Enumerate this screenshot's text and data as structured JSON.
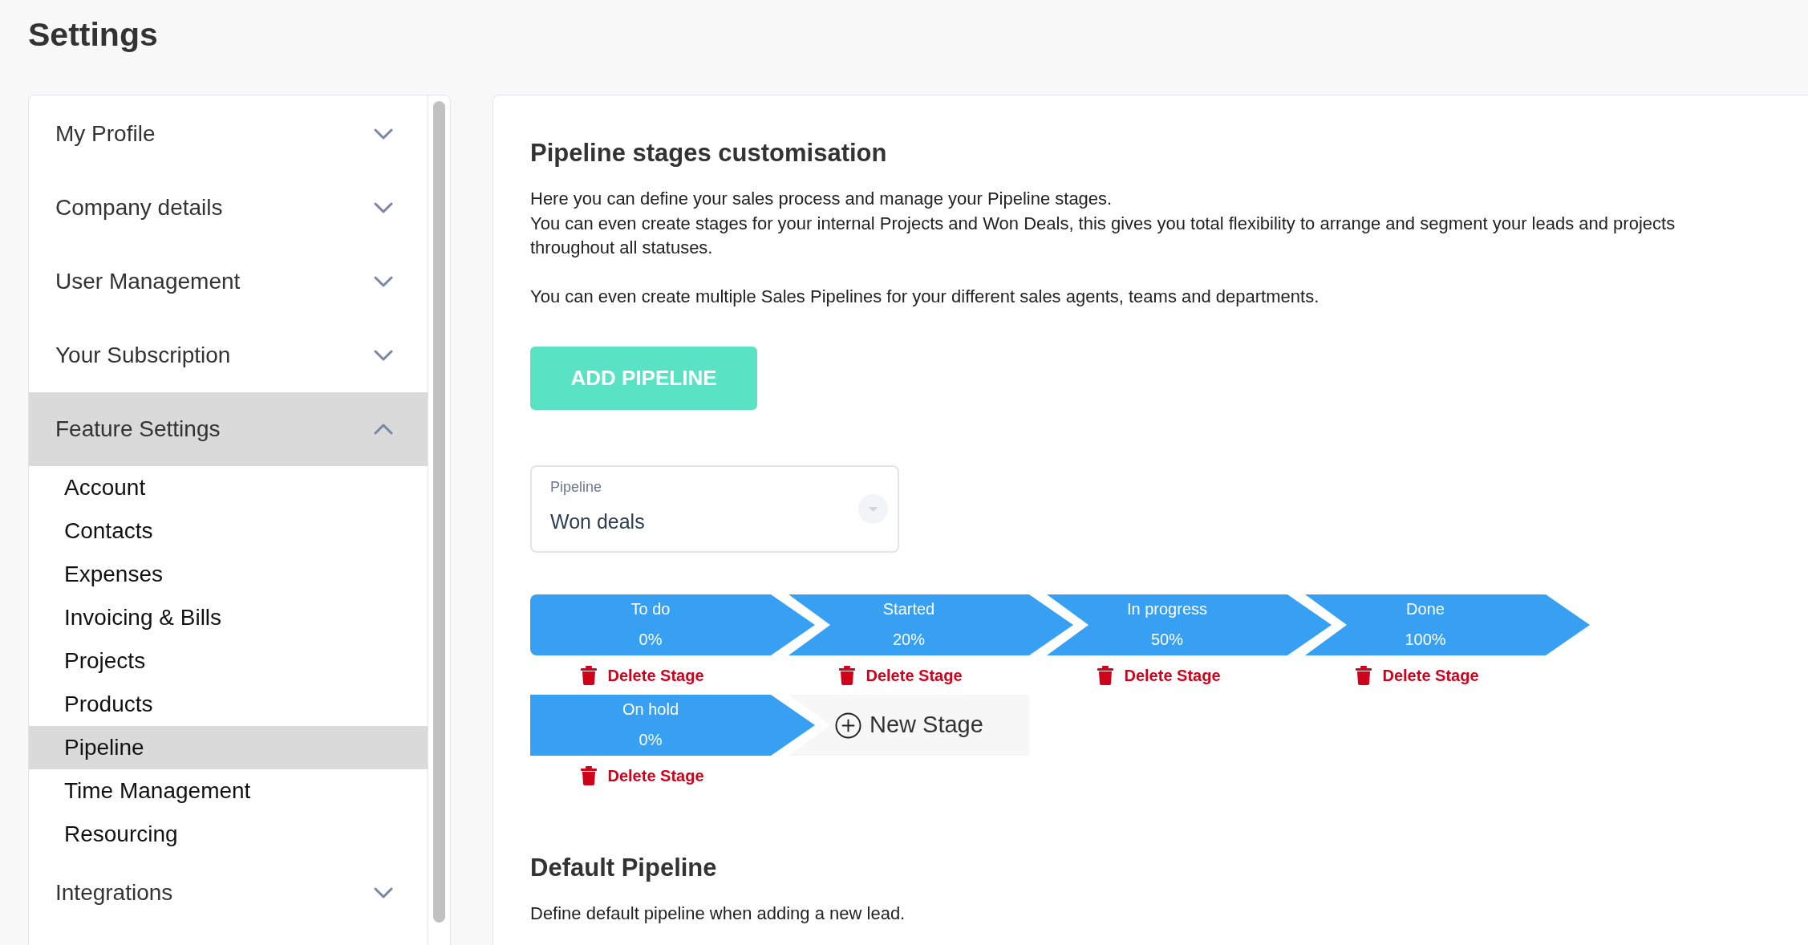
{
  "page_title": "Settings",
  "sidebar": {
    "sections": [
      {
        "label": "My Profile",
        "expanded": false
      },
      {
        "label": "Company details",
        "expanded": false
      },
      {
        "label": "User Management",
        "expanded": false
      },
      {
        "label": "Your Subscription",
        "expanded": false
      },
      {
        "label": "Feature Settings",
        "expanded": true,
        "children": [
          {
            "label": "Account",
            "selected": false
          },
          {
            "label": "Contacts",
            "selected": false
          },
          {
            "label": "Expenses",
            "selected": false
          },
          {
            "label": "Invoicing & Bills",
            "selected": false
          },
          {
            "label": "Projects",
            "selected": false
          },
          {
            "label": "Products",
            "selected": false
          },
          {
            "label": "Pipeline",
            "selected": true
          },
          {
            "label": "Time Management",
            "selected": false
          },
          {
            "label": "Resourcing",
            "selected": false
          }
        ]
      },
      {
        "label": "Integrations",
        "expanded": false
      }
    ]
  },
  "pipeline_stages": {
    "title": "Pipeline stages customisation",
    "paragraphs": [
      [
        "Here you can define your sales process and manage your Pipeline stages.",
        "You can even create stages for your internal Projects and Won Deals, this gives you total flexibility to arrange and segment your leads and projects throughout all statuses."
      ],
      [
        "You can even create multiple Sales Pipelines for your different sales agents, teams and departments."
      ]
    ],
    "add_button": "ADD PIPELINE",
    "pipeline_select": {
      "label": "Pipeline",
      "value": "Won deals"
    },
    "stages": [
      {
        "name": "To do",
        "percent": "0%",
        "delete_label": "Delete Stage"
      },
      {
        "name": "Started",
        "percent": "20%",
        "delete_label": "Delete Stage"
      },
      {
        "name": "In progress",
        "percent": "50%",
        "delete_label": "Delete Stage"
      },
      {
        "name": "Done",
        "percent": "100%",
        "delete_label": "Delete Stage"
      },
      {
        "name": "On hold",
        "percent": "0%",
        "delete_label": "Delete Stage"
      }
    ],
    "new_stage_button": "New Stage"
  },
  "default_pipeline": {
    "title": "Default Pipeline",
    "description": "Define default pipeline when adding a new lead."
  }
}
